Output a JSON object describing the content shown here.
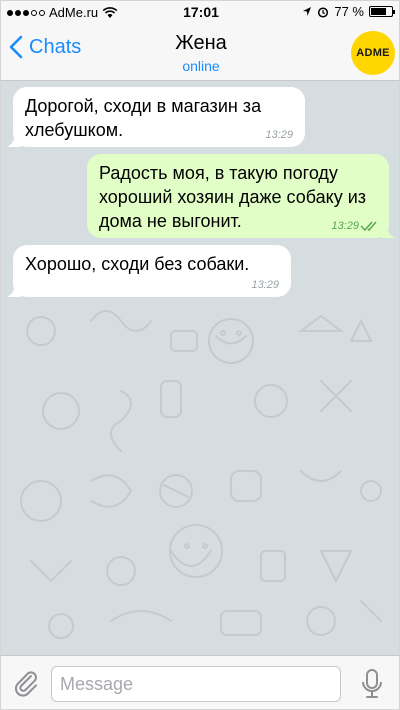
{
  "status_bar": {
    "carrier": "AdMe.ru",
    "time": "17:01",
    "battery": "77 %",
    "battery_level": 0.77,
    "icons": [
      "signal-dots",
      "wifi-icon",
      "location-arrow-icon",
      "alarm-icon",
      "battery-icon"
    ]
  },
  "header": {
    "back_label": "Chats",
    "title": "Жена",
    "subtitle": "online",
    "avatar_text": "ADME",
    "avatar_color": "#ffd600"
  },
  "messages": [
    {
      "direction": "in",
      "text": "Дорогой, сходи в магазин за хлебушком.",
      "time": "13:29"
    },
    {
      "direction": "out",
      "text": "Радость моя, в такую погоду хороший хозяин даже собаку из дома не выгонит.",
      "time": "13:29",
      "status_icon": "double-check-icon"
    },
    {
      "direction": "in",
      "text": "Хорошо, сходи без собаки.",
      "time": "13:29"
    }
  ],
  "input": {
    "placeholder": "Message",
    "value": ""
  },
  "colors": {
    "accent": "#1a8cff",
    "outgoing_bubble": "#e1fec6",
    "incoming_bubble": "#ffffff",
    "chat_background": "#d6dde0"
  }
}
